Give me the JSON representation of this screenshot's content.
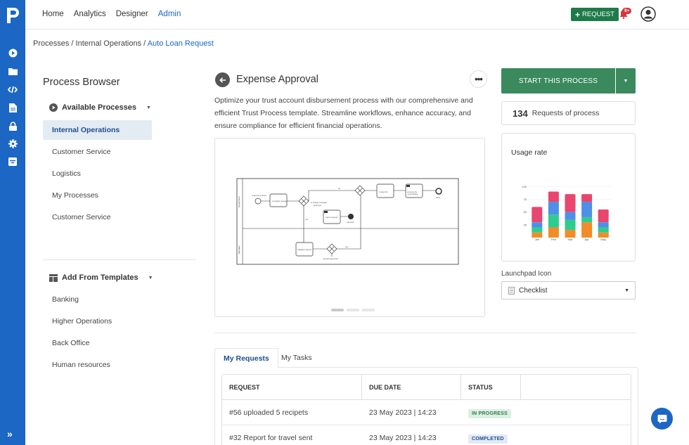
{
  "nav": {
    "items": [
      "Home",
      "Analytics",
      "Designer",
      "Admin"
    ],
    "active": "Admin"
  },
  "topbar": {
    "request_label": "REQUEST",
    "notification_badge": "9+"
  },
  "breadcrumb": {
    "items": [
      "Processes",
      "Internal Operations"
    ],
    "current": "Auto Loan Request",
    "separator": "/"
  },
  "process_browser": {
    "title": "Process Browser",
    "available_label": "Available Processes",
    "available_items": [
      "Internal Operations",
      "Customer Service",
      "Logistics",
      "My Processes",
      "Customer Service"
    ],
    "selected": "Internal Operations",
    "templates_label": "Add From Templates",
    "template_items": [
      "Banking",
      "Higher Operations",
      "Back Office",
      "Human resources"
    ]
  },
  "process": {
    "title": "Expense Approval",
    "description": "Optimize your trust account disbursement process with our comprehensive and efficient Trust Process template. Streamline workflows, enhance accuracy, and ensure compliance for efficient financial operations."
  },
  "actions": {
    "start_label": "START THIS PROCESS"
  },
  "requests": {
    "count": "134",
    "label": "Requests of process"
  },
  "usage": {
    "title": "Usage rate",
    "colors": [
      "#f28c28",
      "#2ecc8f",
      "#4e8fe8",
      "#e8466e"
    ]
  },
  "chart_data": {
    "type": "bar",
    "categories": [
      "Jan",
      "Feb",
      "Mar",
      "Apr",
      "May"
    ],
    "series": [
      {
        "values": [
          10,
          20,
          15,
          30,
          10
        ]
      },
      {
        "values": [
          10,
          25,
          20,
          10,
          10
        ]
      },
      {
        "values": [
          10,
          25,
          15,
          30,
          10
        ]
      },
      {
        "values": [
          30,
          20,
          35,
          15,
          25
        ]
      }
    ],
    "yticks": [
      "100",
      "75",
      "50",
      "25"
    ],
    "ylim": [
      0,
      110
    ]
  },
  "launchpad": {
    "label": "Launchpad Icon",
    "selected": "Checklist"
  },
  "tabs": [
    "My Requests",
    "My Tasks"
  ],
  "table": {
    "headers": [
      "REQUEST",
      "DUE DATE",
      "STATUS"
    ],
    "rows": [
      {
        "request": "#56 uploaded 5 recipets",
        "due": "23 May 2023 | 14:23",
        "status": "IN PROGRESS",
        "kind": "progress"
      },
      {
        "request": "#32 Report for travel sent",
        "due": "23 May 2023 | 14:23",
        "status": "COMPLETED",
        "kind": "completed"
      }
    ]
  }
}
